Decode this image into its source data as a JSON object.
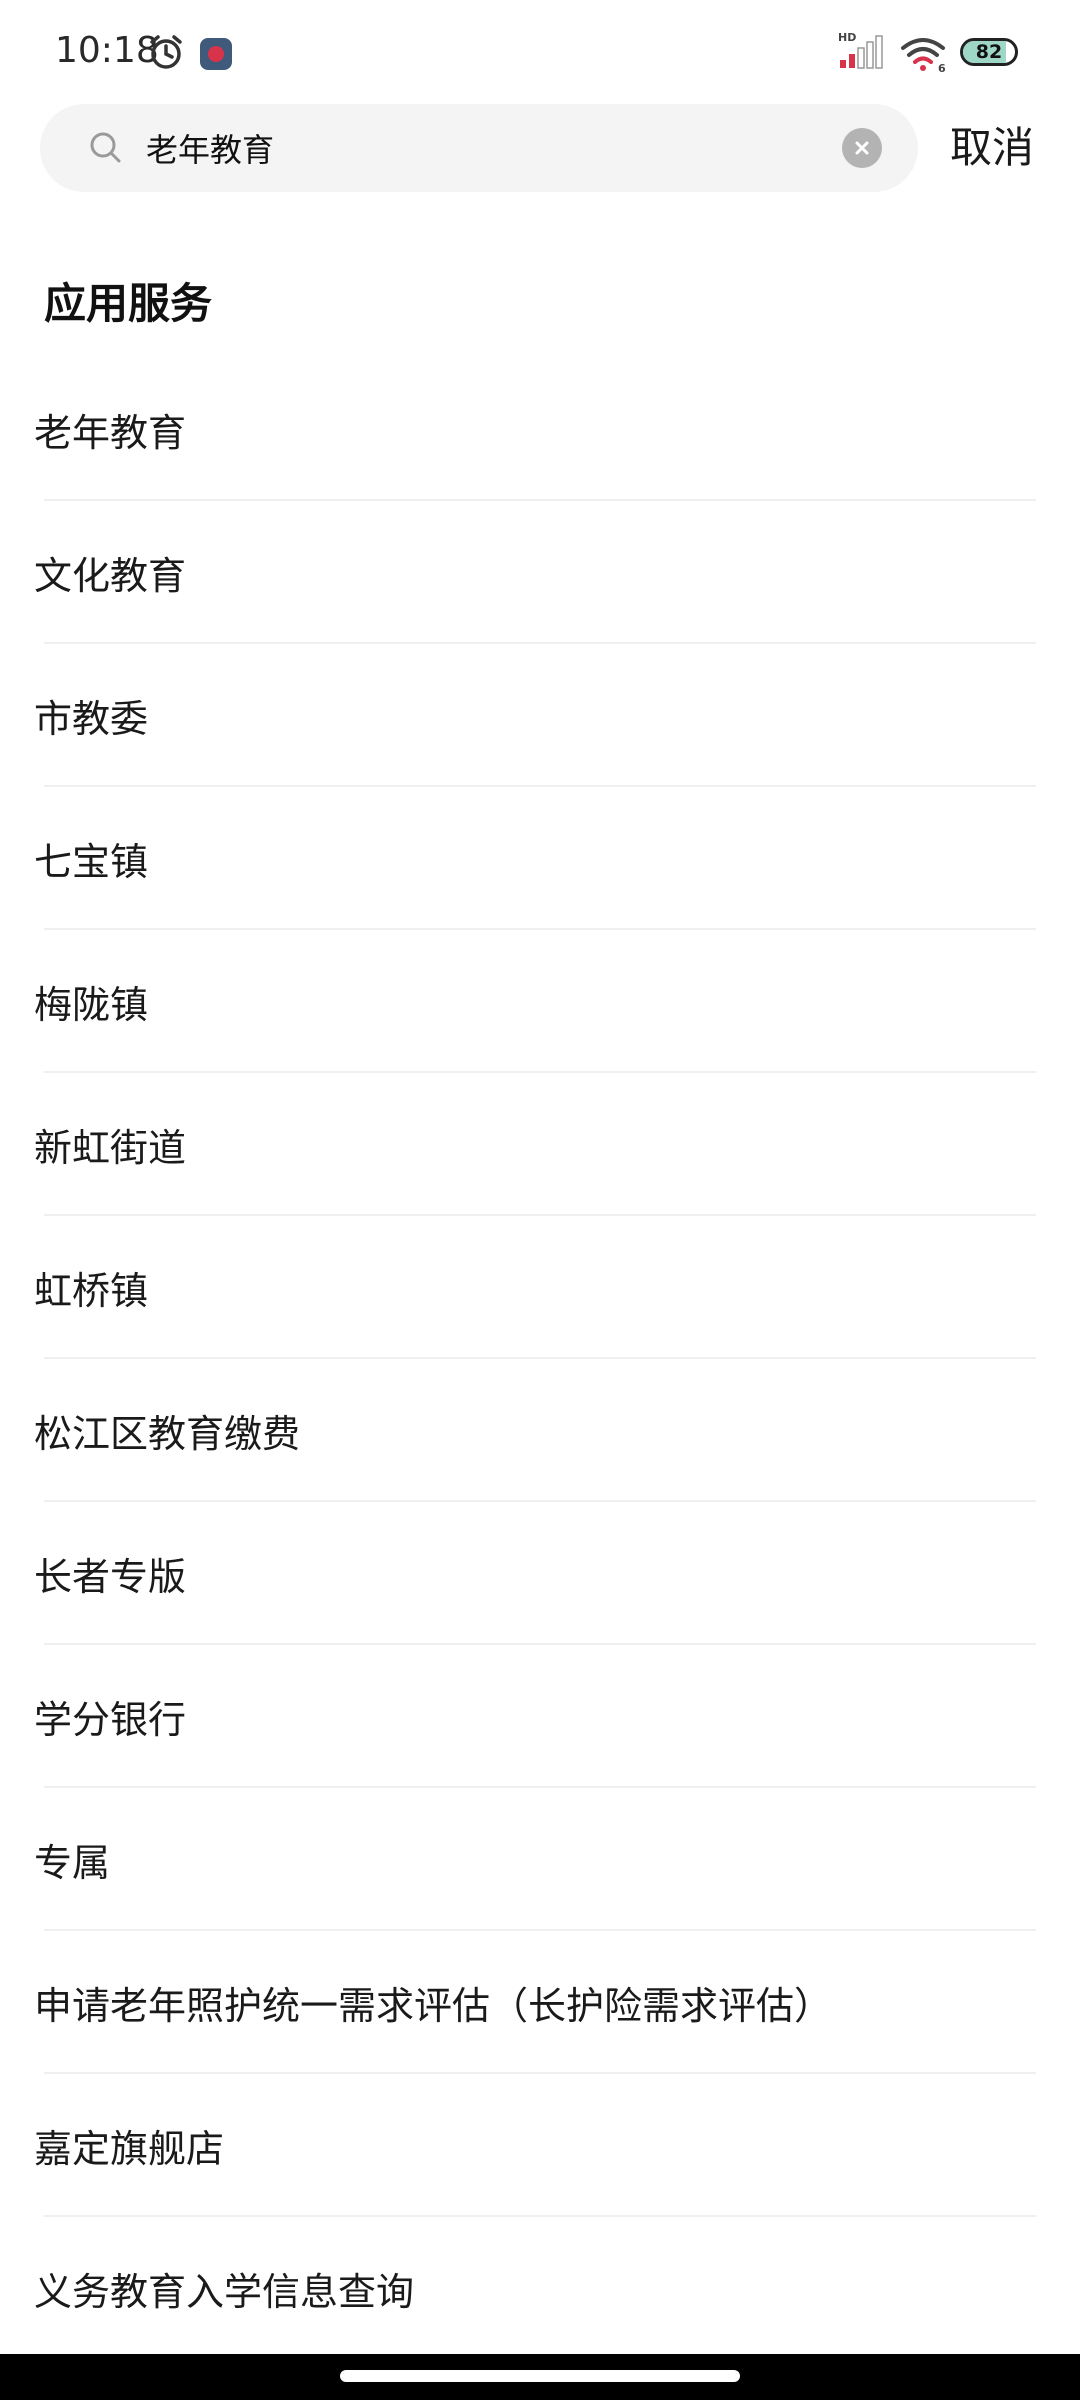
{
  "status_bar": {
    "time": "10:18",
    "network_label": "HD",
    "wifi_label": "6",
    "battery_level": "82",
    "battery_fraction": 0.82
  },
  "search": {
    "query": "老年教育",
    "cancel_label": "取消"
  },
  "section": {
    "title": "应用服务"
  },
  "results": [
    {
      "label": "老年教育"
    },
    {
      "label": "文化教育"
    },
    {
      "label": "市教委"
    },
    {
      "label": "七宝镇"
    },
    {
      "label": "梅陇镇"
    },
    {
      "label": "新虹街道"
    },
    {
      "label": "虹桥镇"
    },
    {
      "label": "松江区教育缴费"
    },
    {
      "label": "长者专版"
    },
    {
      "label": "学分银行"
    },
    {
      "label": "专属"
    },
    {
      "label": "申请老年照护统一需求评估（长护险需求评估）"
    },
    {
      "label": "嘉定旗舰店"
    },
    {
      "label": "义务教育入学信息查询"
    }
  ],
  "icons": {
    "status_left": [
      "alarm-clock-icon",
      "app-notification-icon"
    ],
    "status_right": [
      "cellular-signal-icon",
      "wifi-icon",
      "battery-icon"
    ],
    "search": "search-icon",
    "clear": "clear-icon"
  },
  "colors": {
    "background": "#ffffff",
    "search_background": "#f4f4f4",
    "divider": "#efefef",
    "caret": "#d49a3a",
    "battery_fill": "#9fd7c7",
    "signal_active": "#d8334a"
  }
}
